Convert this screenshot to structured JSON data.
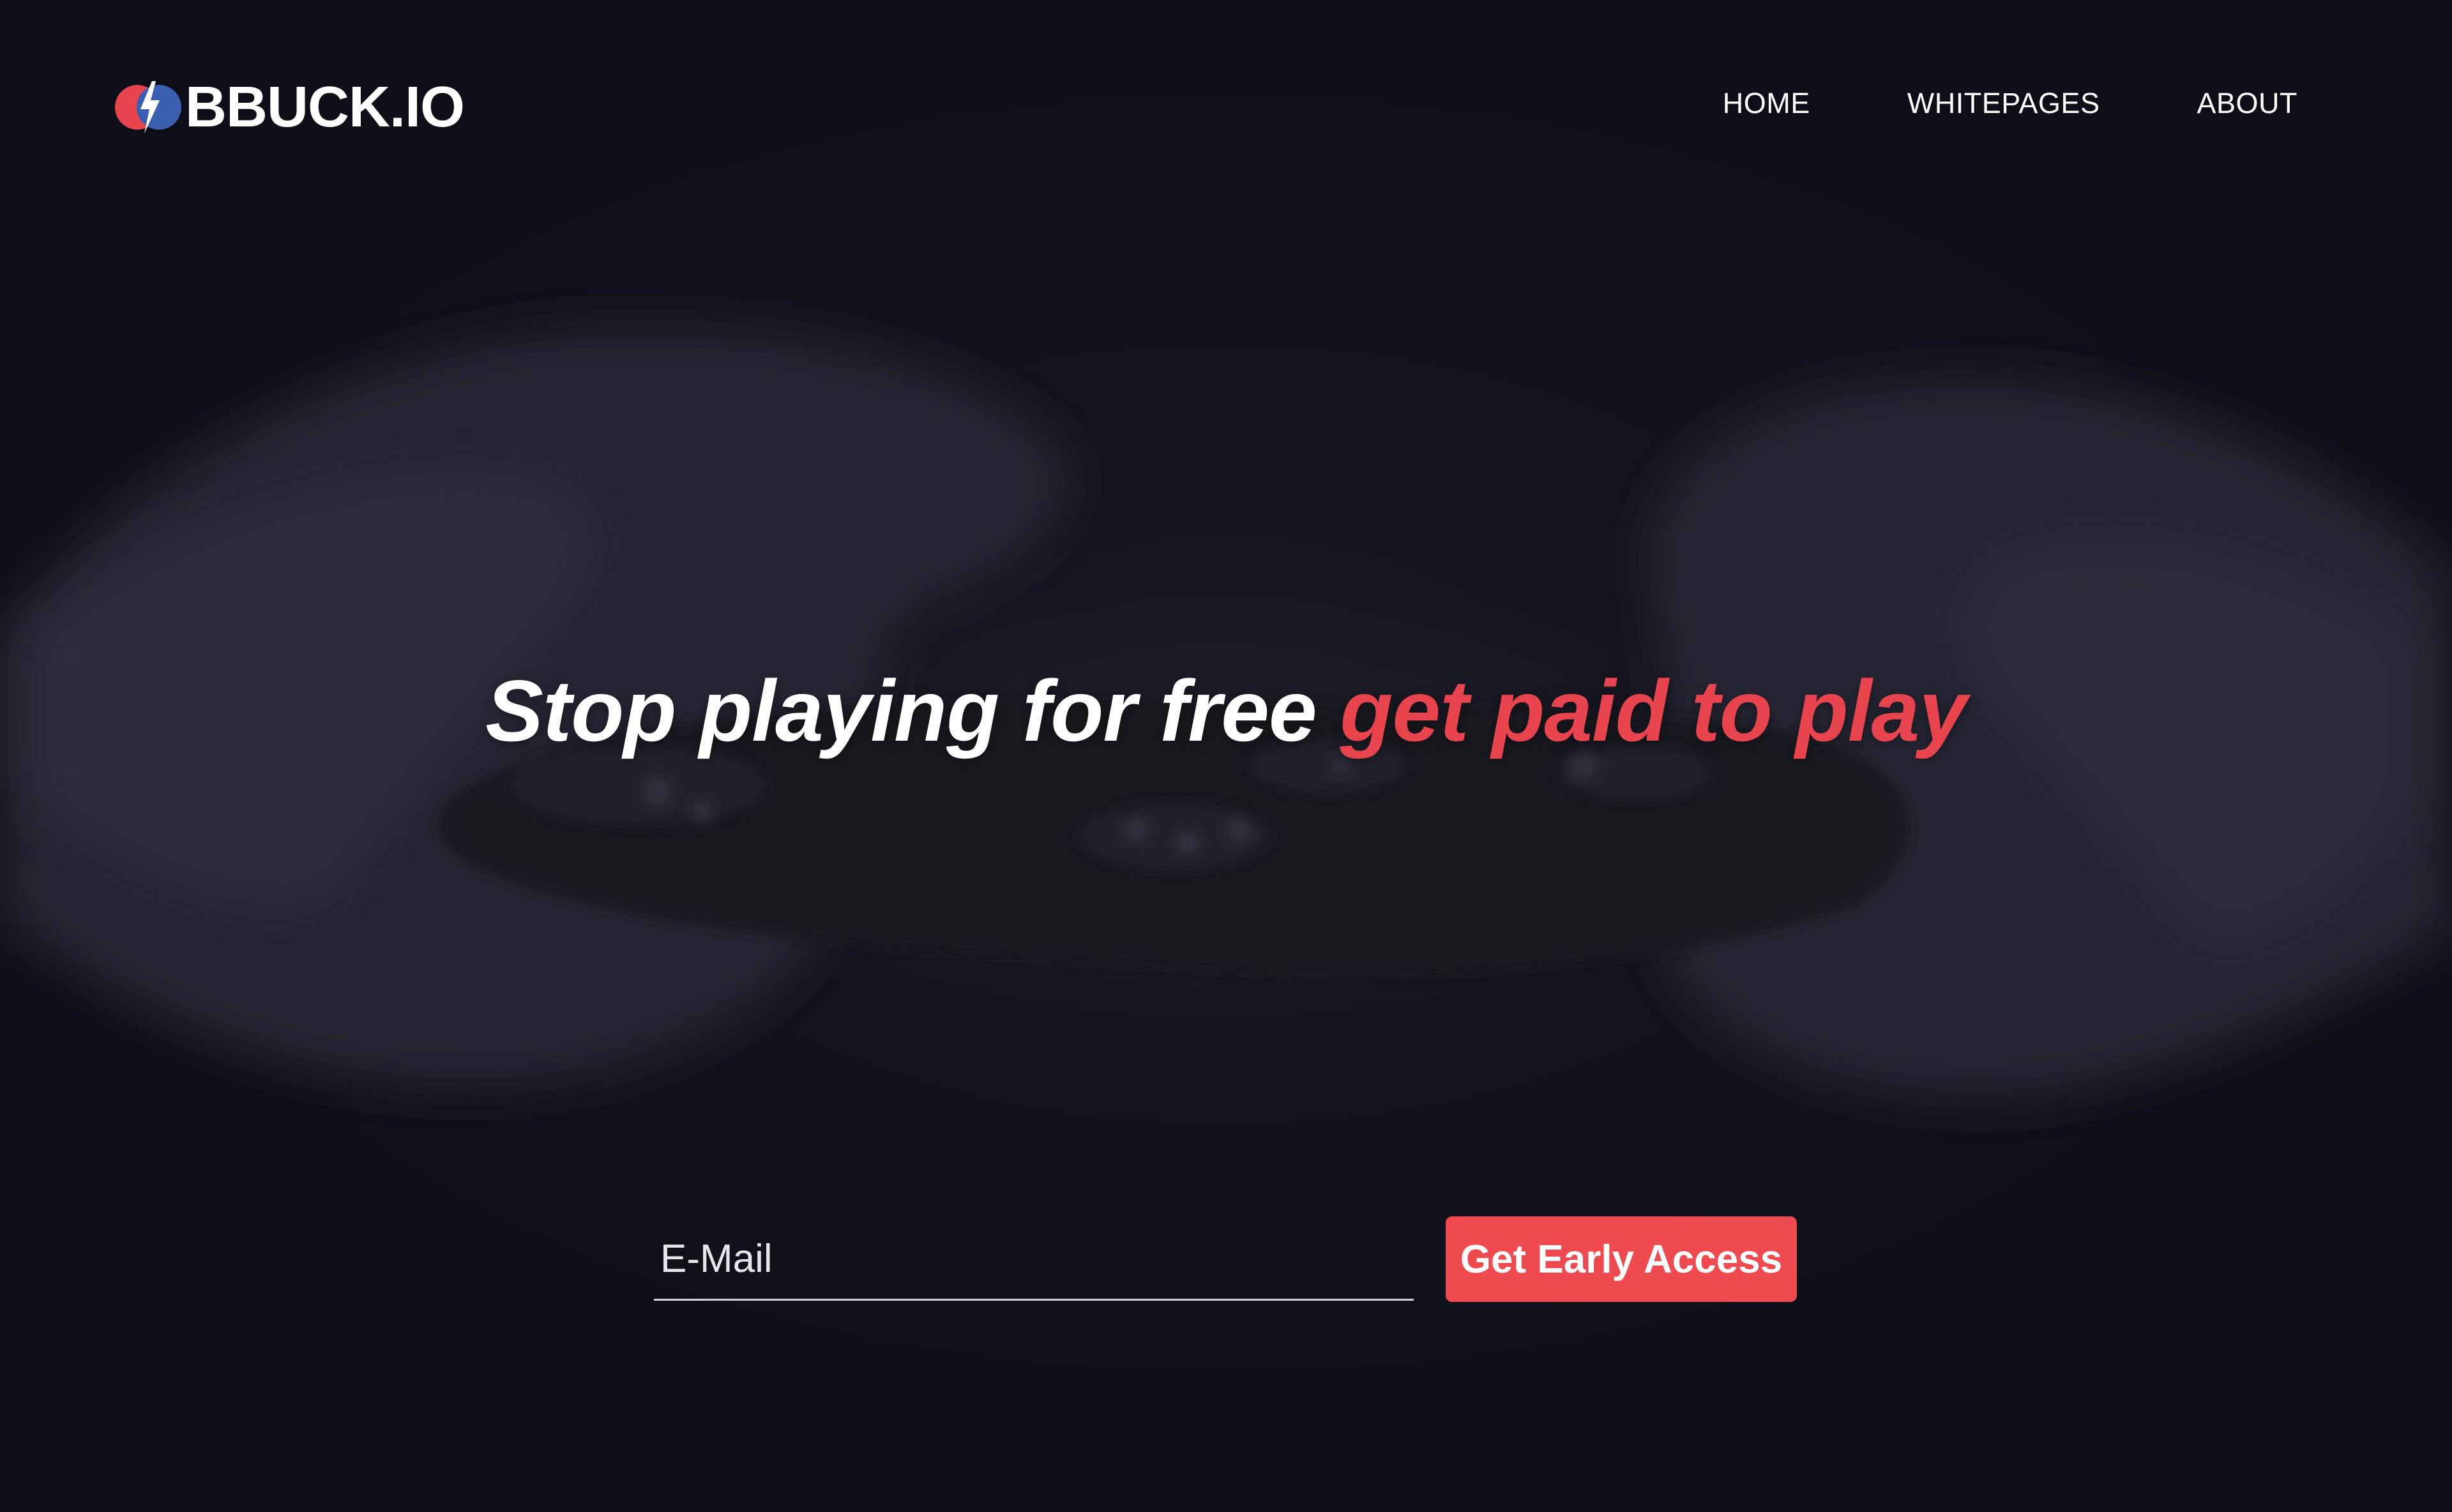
{
  "brand": {
    "name": "BBUCK.IO",
    "logo_icon": "lightning-bolt-icon",
    "colors": {
      "red": "#e8444d",
      "blue": "#3a5fb0"
    }
  },
  "nav": {
    "items": [
      {
        "label": "HOME"
      },
      {
        "label": "WHITEPAGES"
      },
      {
        "label": "ABOUT"
      }
    ]
  },
  "hero": {
    "headline_main": "Stop playing for free ",
    "headline_accent": "get paid to play",
    "accent_color": "#e8444d",
    "background_image": "hands-holding-game-controller"
  },
  "signup": {
    "email_placeholder": "E-Mail",
    "email_value": "",
    "cta_label": "Get Early Access",
    "cta_color": "#ee4a50"
  }
}
